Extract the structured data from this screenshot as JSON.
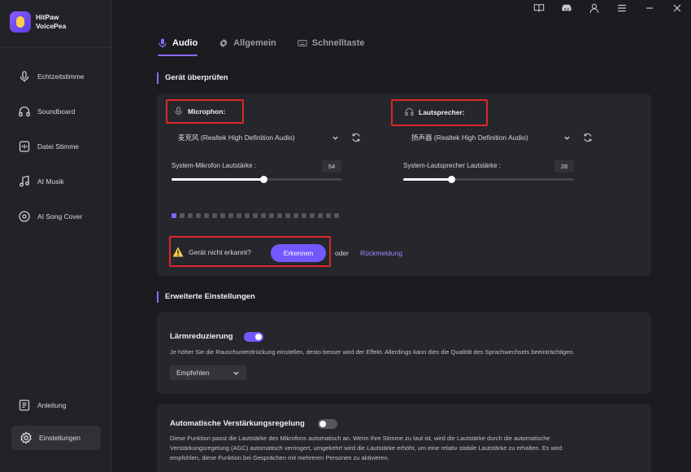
{
  "brand": {
    "line1": "HitPaw",
    "line2": "VoicePea"
  },
  "nav": [
    {
      "label": "Echtzeitstimme",
      "icon": "mic-wave-icon"
    },
    {
      "label": "Soundboard",
      "icon": "headphones-icon"
    },
    {
      "label": "Datei Stimme",
      "icon": "file-voice-icon"
    },
    {
      "label": "AI Musik",
      "icon": "music-note-icon"
    },
    {
      "label": "AI Song Cover",
      "icon": "vinyl-icon"
    }
  ],
  "nav_bottom": {
    "guide": "Anleitung",
    "settings": "Einstellungen"
  },
  "tabs": [
    {
      "label": "Audio",
      "icon": "mic-icon",
      "active": true
    },
    {
      "label": "Allgemein",
      "icon": "gear-icon",
      "active": false
    },
    {
      "label": "Schnelltaste",
      "icon": "keyboard-icon",
      "active": false
    }
  ],
  "device_check": {
    "title": "Gerät überprüfen",
    "microphone": {
      "label": "Microphon:",
      "device": "麦克风 (Realtek High Definition Audio)",
      "volume_label": "System-Mikrofon Lautstärke :",
      "volume": 54
    },
    "speaker": {
      "label": "Lautsprecher:",
      "device": "扬声器 (Realtek High Definition Audio)",
      "volume_label": "System-Lautsprecher Lautstärke :",
      "volume": 28
    },
    "meter_level": 0.05,
    "not_detected": "Gerät nicht erkannt?",
    "detect_button": "Erkennen",
    "or": "oder",
    "feedback": "Rückmeldung"
  },
  "advanced": {
    "title": "Erweiterte Einstellungen",
    "noise": {
      "title": "Lärmreduzierung",
      "enabled": true,
      "desc": "Je höher Sie die Rauschunterdrückung einstellen, desto besser wird der Effekt. Allerdings kann dies die Qualität des Sprachwechsels beeinträchtigen.",
      "level": "Empfehlen"
    },
    "agc": {
      "title": "Automatische Verstärkungsregelung",
      "enabled": false,
      "desc_1": "Diese Funktion passt die Lautstärke des Mikrofons automatisch an. Wenn Ihre Stimme zu laut ist, wird die Lautstärke durch die automatische",
      "desc_2": "Verstärkungsregelung (AGC) automatisch verringert, umgekehrt wird die Lautstärke erhöht, um eine relativ stabile Lautstärke zu erhalten. Es wird",
      "desc_3": "empfohlen, diese Funktion bei Gesprächen mit mehreren Personen zu aktivieren."
    }
  },
  "colors": {
    "accent": "#7259ff",
    "highlight": "#e0262a",
    "toggle_off": "#55565e"
  }
}
